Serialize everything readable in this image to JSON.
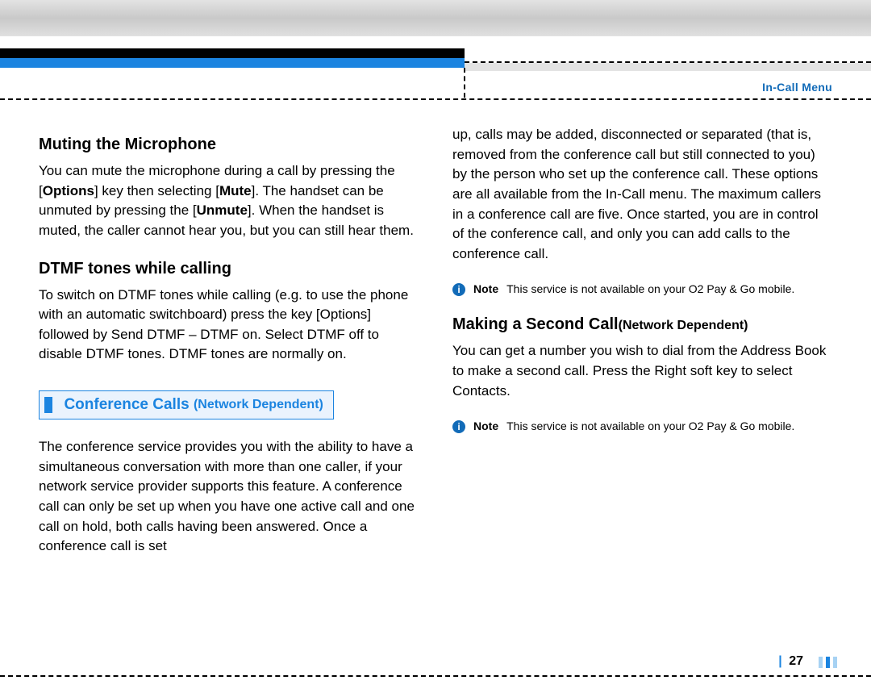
{
  "header": {
    "section_label": "In-Call Menu"
  },
  "left": {
    "h1": "Muting the Microphone",
    "p1_a": "You can mute the microphone during a call by pressing the [",
    "p1_b_options": "Options",
    "p1_c": "] key then selecting  [",
    "p1_b_mute": "Mute",
    "p1_d": "]. The handset can be unmuted by pressing the [",
    "p1_b_unmute": "Unmute",
    "p1_e": "]. When the handset is muted, the caller cannot hear you, but you can still hear them.",
    "h2": "DTMF tones while calling",
    "p2": "To switch on DTMF tones while calling (e.g. to use the phone with an automatic switchboard) press the key [Options] followed by Send DTMF – DTMF on. Select DTMF off to disable DTMF tones. DTMF tones are normally on.",
    "callout_title": "Conference Calls ",
    "callout_sub": "(Network Dependent)",
    "p3": "The conference service provides you with the ability to have a simultaneous conversation with more than one caller, if your network service provider supports this feature. A conference call can only be set up when you have one active call and one call on hold, both calls having been answered. Once a conference call is set"
  },
  "right": {
    "p1": "up, calls may be added, disconnected or separated (that is, removed from the conference call but still connected to you) by the person who set up the conference call. These options are all available from the In-Call menu. The maximum callers in a conference call are five. Once started, you are in control of the conference  call, and only you can add calls to the conference call.",
    "note1_label": "Note",
    "note1_text": "This service is not available on your O2 Pay & Go mobile.",
    "h1_a": "Making a Second Call",
    "h1_b": "(Network Dependent)",
    "p2": "You can get a number you wish to dial from the Address Book to make a second call. Press the Right soft key to select Contacts.",
    "note2_label": "Note",
    "note2_text": "This service is not available on your O2 Pay & Go mobile."
  },
  "footer": {
    "page_number": "27"
  }
}
